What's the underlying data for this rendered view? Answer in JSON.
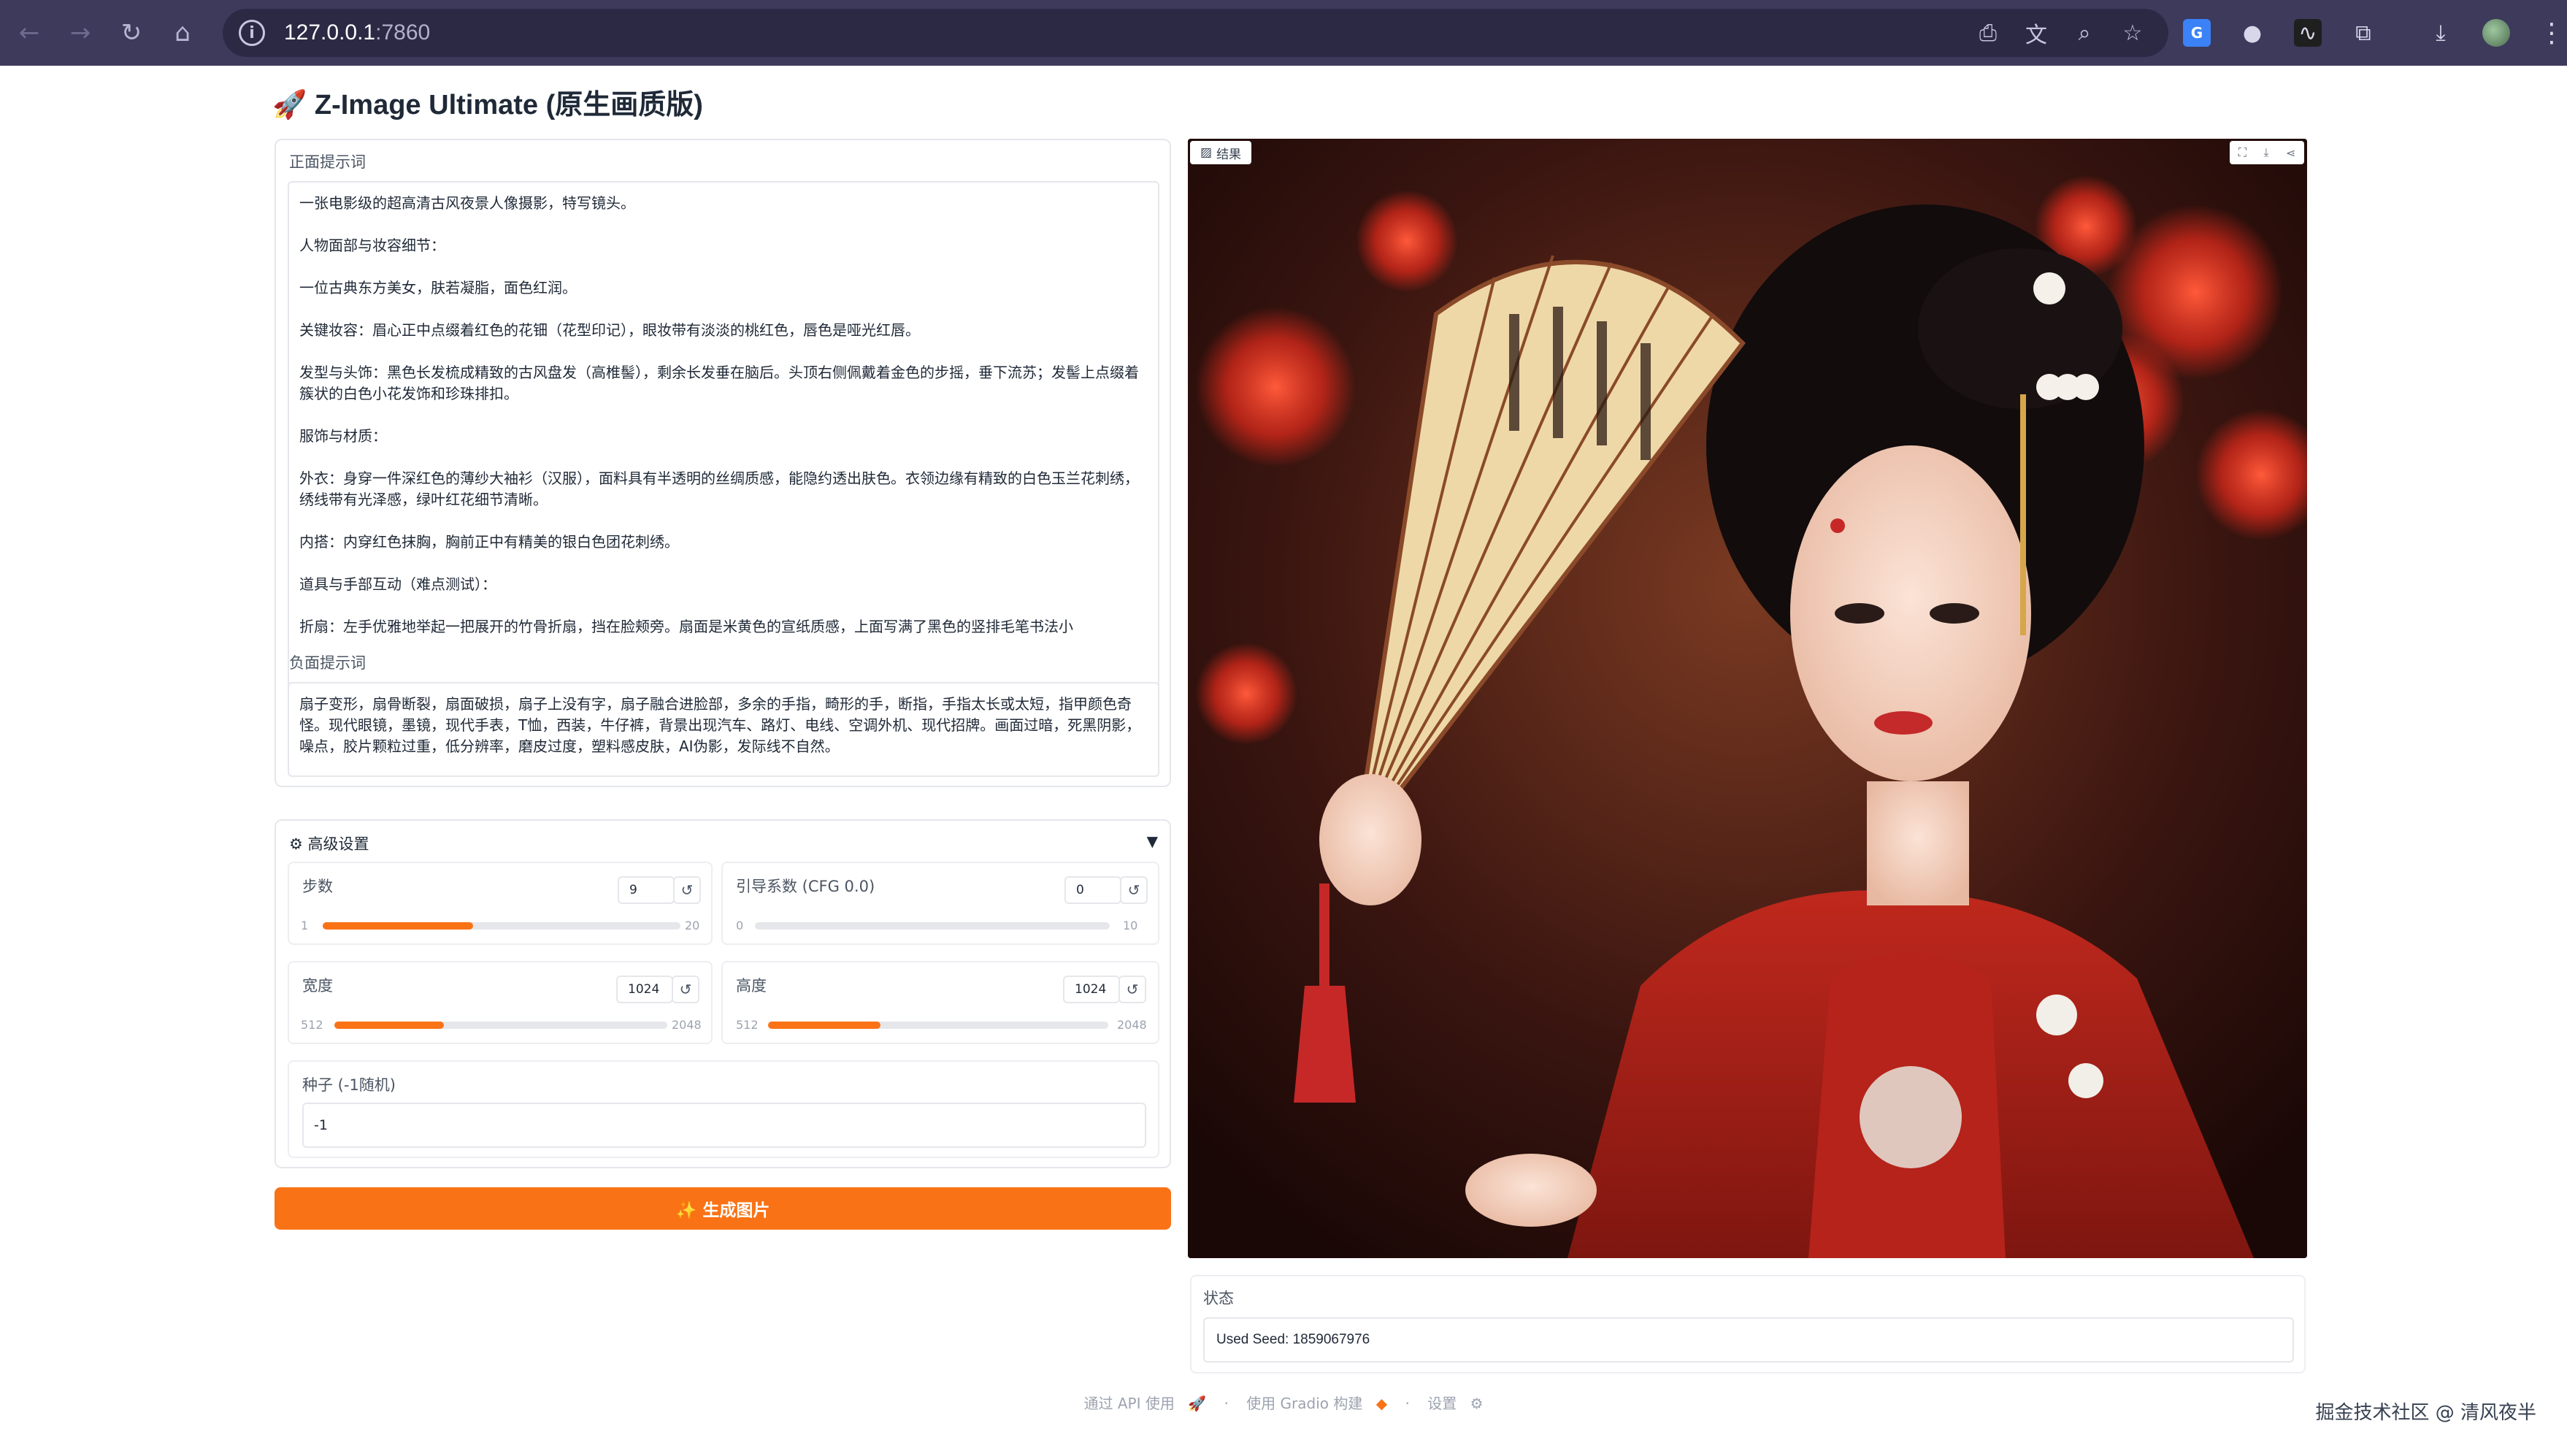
{
  "browser": {
    "url_host": "127.0.0.1",
    "url_port": ":7860"
  },
  "app": {
    "title": "🚀 Z-Image Ultimate (原生画质版)"
  },
  "prompt": {
    "label": "正面提示词",
    "value": "一张电影级的超高清古风夜景人像摄影，特写镜头。\n\n人物面部与妆容细节：\n\n一位古典东方美女，肤若凝脂，面色红润。\n\n关键妆容：眉心正中点缀着红色的花钿（花型印记），眼妆带有淡淡的桃红色，唇色是哑光红唇。\n\n发型与头饰：黑色长发梳成精致的古风盘发（高椎髻），剩余长发垂在脑后。头顶右侧佩戴着金色的步摇，垂下流苏；发髻上点缀着簇状的白色小花发饰和珍珠排扣。\n\n服饰与材质：\n\n外衣：身穿一件深红色的薄纱大袖衫（汉服），面料具有半透明的丝绸质感，能隐约透出肤色。衣领边缘有精致的白色玉兰花刺绣，绣线带有光泽感，绿叶红花细节清晰。\n\n内搭：内穿红色抹胸，胸前正中有精美的银白色团花刺绣。\n\n道具与手部互动（难点测试）：\n\n折扇：左手优雅地举起一把展开的竹骨折扇，挡在脸颊旁。扇面是米黄色的宣纸质感，上面写满了黑色的竖排毛笔书法小"
  },
  "negative_prompt": {
    "label": "负面提示词",
    "value": "扇子变形，扇骨断裂，扇面破损，扇子上没有字，扇子融合进脸部，多余的手指，畸形的手，断指，手指太长或太短，指甲颜色奇怪。现代眼镜，墨镜，现代手表，T恤，西装，牛仔裤，背景出现汽车、路灯、电线、空调外机、现代招牌。画面过暗，死黑阴影，噪点，胶片颗粒过重，低分辨率，磨皮过度，塑料感皮肤，AI伪影，发际线不自然。"
  },
  "advanced": {
    "title": "⚙ 高级设置",
    "toggle": "▼"
  },
  "steps": {
    "label": "步数",
    "value": "9",
    "min": "1",
    "max": "20",
    "fraction": 0.42
  },
  "cfg": {
    "label": "引导系数 (CFG 0.0)",
    "value": "0",
    "min": "0",
    "max": "10",
    "fraction": 0.0
  },
  "width": {
    "label": "宽度",
    "value": "1024",
    "min": "512",
    "max": "2048",
    "fraction": 0.33
  },
  "height": {
    "label": "高度",
    "value": "1024",
    "min": "512",
    "max": "2048",
    "fraction": 0.33
  },
  "seed": {
    "label": "种子 (-1随机)",
    "value": "-1"
  },
  "generate": {
    "label": "✨ 生成图片"
  },
  "result": {
    "label": "结果"
  },
  "status": {
    "label": "状态",
    "value": "Used Seed: 1859067976"
  },
  "footer": {
    "api": "通过 API 使用",
    "built": "使用 Gradio 构建",
    "settings": "设置"
  },
  "watermark": "掘金技术社区 @ 清风夜半",
  "colors": {
    "accent": "#f97316",
    "browser": "#3d3a5c"
  }
}
